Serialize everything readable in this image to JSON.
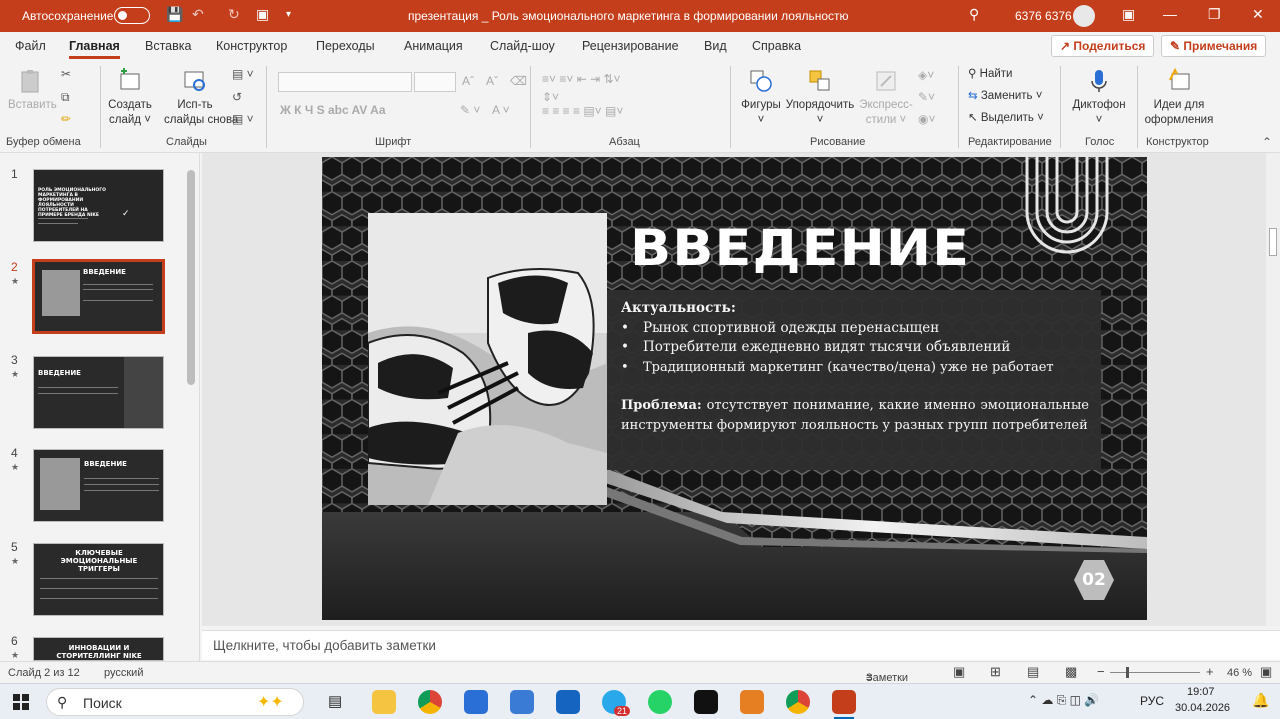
{
  "titlebar": {
    "autosave_label": "Автосохранение",
    "autosave_state": "Откл.",
    "doc_title": "презентация _ Роль эмоционального маркетинга в формировании лояльностю...",
    "user_name": "6376 6376",
    "bg_color": "#c43e1c"
  },
  "menu": {
    "tabs": [
      "Файл",
      "Главная",
      "Вставка",
      "Конструктор",
      "Переходы",
      "Анимация",
      "Слайд-шоу",
      "Рецензирование",
      "Вид",
      "Справка"
    ],
    "active_tab": "Главная",
    "share_label": "Поделиться",
    "comments_label": "Примечания"
  },
  "ribbon": {
    "groups": {
      "clipboard": "Буфер обмена",
      "slides": "Слайды",
      "font": "Шрифт",
      "paragraph": "Абзац",
      "drawing": "Рисование",
      "editing": "Редактирование",
      "voice": "Голос",
      "designer": "Конструктор"
    },
    "paste_label": "Вставить",
    "new_slide_1": "Создать",
    "new_slide_2": "слайд",
    "reuse_1": "Исп-ть",
    "reuse_2": "слайды снова",
    "shapes_label": "Фигуры",
    "arrange_label": "Упорядочить",
    "quick_styles_1": "Экспресс-",
    "quick_styles_2": "стили",
    "find_label": "Найти",
    "replace_label": "Заменить",
    "select_label": "Выделить",
    "dictate_label": "Диктофон",
    "design_ideas_1": "Идеи для",
    "design_ideas_2": "оформления",
    "font_buttons": "Ж  К  Ч  S  abc  AV  Aa"
  },
  "thumbnails": [
    {
      "num": "1",
      "title": "РОЛЬ ЭМОЦИОНАЛЬНОГО МАРКЕТИНГА В ФОРМИРОВАНИИ ЛОЯЛЬНОСТИ ПОТРЕБИТЕЛЕЙ НА ПРИМЕРЕ БРЕНДА NIKE",
      "star": ""
    },
    {
      "num": "2",
      "title": "ВВЕДЕНИЕ",
      "star": "★"
    },
    {
      "num": "3",
      "title": "ВВЕДЕНИЕ",
      "star": "★"
    },
    {
      "num": "4",
      "title": "ВВЕДЕНИЕ",
      "star": "★"
    },
    {
      "num": "5",
      "title": "КЛЮЧЕВЫЕ ЭМОЦИОНАЛЬНЫЕ ТРИГГЕРЫ",
      "star": "★"
    },
    {
      "num": "6",
      "title": "ИННОВАЦИИ И СТОРИТЕЛЛИНГ NIKE",
      "star": "★"
    }
  ],
  "slide": {
    "title": "ВВЕДЕНИЕ",
    "relevance_heading": "Актуальность:",
    "bullets": [
      "Рынок спортивной одежды перенасыщен",
      "Потребители ежедневно видят тысячи объявлений",
      "Традиционный маркетинг (качество/цена) уже не работает"
    ],
    "problem_label": "Проблема:",
    "problem_text": "отсутствует понимание, какие именно эмоциональные инструменты формируют лояльность у разных групп потребителей",
    "page_number": "02"
  },
  "notes_placeholder": "Щелкните, чтобы добавить заметки",
  "status": {
    "slide_info": "Слайд 2 из 12",
    "language": "русский",
    "notes_button": "Заметки",
    "zoom": "46 %"
  },
  "taskbar": {
    "search_placeholder": "Поиск",
    "lang": "РУС",
    "time": "19:07",
    "date": "30.04.2026",
    "telegram_badge": "21"
  }
}
